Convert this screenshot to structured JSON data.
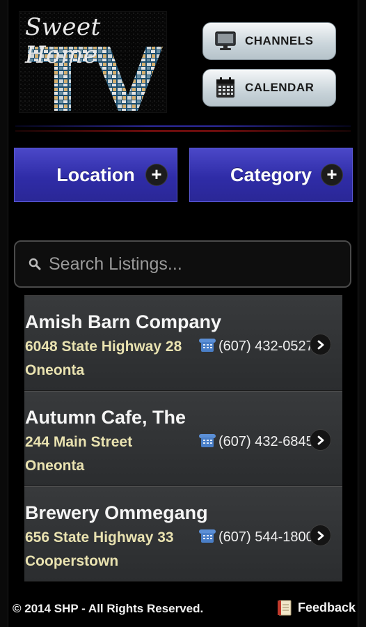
{
  "header": {
    "logo_text": "Sweet Home",
    "channels_label": "CHANNELS",
    "calendar_label": "CALENDAR"
  },
  "filters": {
    "location_label": "Location",
    "category_label": "Category"
  },
  "search": {
    "placeholder": "Search Listings..."
  },
  "listings": [
    {
      "name": "Amish Barn Company",
      "address": "6048 State Highway 28",
      "city": "Oneonta",
      "phone": "(607) 432-0527"
    },
    {
      "name": "Autumn Cafe, The",
      "address": "244 Main Street",
      "city": "Oneonta",
      "phone": "(607) 432-6845"
    },
    {
      "name": "Brewery Ommegang",
      "address": "656 State Highway 33",
      "city": "Cooperstown",
      "phone": "(607) 544-1800"
    }
  ],
  "footer": {
    "copyright": "© 2014 SHP - All Rights Reserved.",
    "feedback_label": "Feedback"
  },
  "colors": {
    "accent_blue": "#2f2ca7",
    "address_text": "#e9e2b0",
    "background": "#000000"
  },
  "icons": [
    "monitor-icon",
    "calendar-icon",
    "plus-icon",
    "search-icon",
    "phone-icon",
    "chevron-right-icon",
    "notepad-icon"
  ]
}
